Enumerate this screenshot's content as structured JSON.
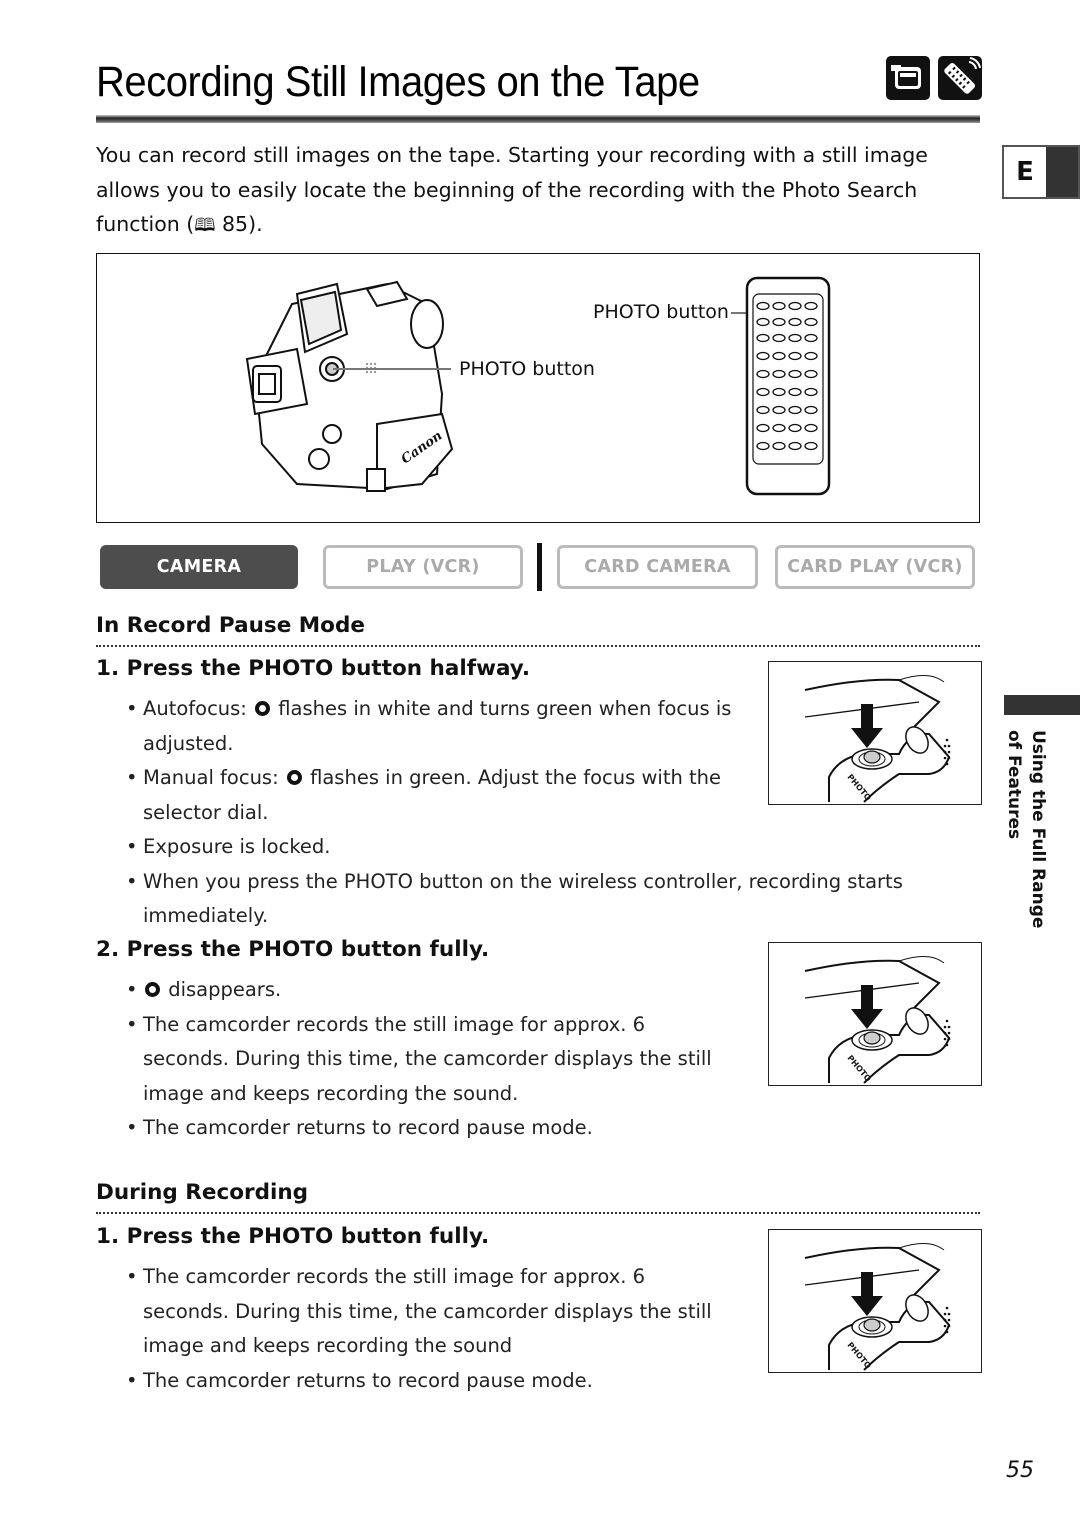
{
  "page": {
    "title": "Recording Still Images on the Tape",
    "header_icons": [
      "camcorder-mode-icon",
      "wireless-controller-icon"
    ],
    "language_tab": "E",
    "side_tab": {
      "line1": "Using the Full Range",
      "line2": "of Features"
    },
    "page_number": "55"
  },
  "intro": {
    "text_before": "You can record still images on the tape. Starting your recording with a still image allows you to easily locate the beginning of the recording with the Photo Search function (",
    "book_icon": "book-icon",
    "text_after": " 85)."
  },
  "figure": {
    "camera_callout": "PHOTO button",
    "remote_callout": "PHOTO button",
    "brand_label": "Canon"
  },
  "modes": [
    {
      "label": "CAMERA",
      "active": true
    },
    {
      "label": "PLAY (VCR)",
      "active": false
    },
    {
      "label": "CARD CAMERA",
      "active": false
    },
    {
      "label": "CARD PLAY (VCR)",
      "active": false
    }
  ],
  "record_pause": {
    "heading": "In Record Pause Mode",
    "step1": {
      "title": "1. Press the PHOTO button halfway.",
      "bullets": [
        {
          "before": "Autofocus: ",
          "glyph": true,
          "after": " flashes in white and turns green when focus is adjusted."
        },
        {
          "before": "Manual focus: ",
          "glyph": true,
          "after": " flashes in green. Adjust the focus with the selector dial."
        },
        {
          "before": "Exposure is locked.",
          "glyph": false,
          "after": ""
        },
        {
          "before": "When you press the PHOTO button on the wireless controller, recording starts immediately.",
          "glyph": false,
          "after": ""
        }
      ]
    },
    "step2": {
      "title": "2. Press the PHOTO button fully.",
      "bullets": [
        {
          "before": "",
          "glyph": true,
          "after": " disappears."
        },
        {
          "before": "The camcorder records the still image for approx. 6 seconds. During this time, the camcorder displays the still image and keeps recording the sound.",
          "glyph": false,
          "after": ""
        },
        {
          "before": "The camcorder returns to record pause mode.",
          "glyph": false,
          "after": ""
        }
      ]
    }
  },
  "during_recording": {
    "heading": "During Recording",
    "step1": {
      "title": "1. Press the PHOTO button fully.",
      "bullets": [
        {
          "before": "The camcorder records the still image for approx. 6 seconds. During this time, the camcorder displays the still image and keeps recording the sound",
          "glyph": false,
          "after": ""
        },
        {
          "before": "The camcorder returns to record pause mode.",
          "glyph": false,
          "after": ""
        }
      ]
    }
  },
  "illustration_label": "PHOTO"
}
